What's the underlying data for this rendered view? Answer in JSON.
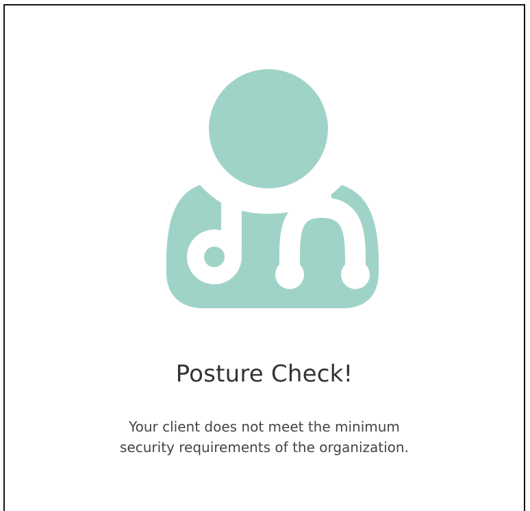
{
  "illustration": {
    "icon": "doctor-stethoscope-icon",
    "color": "#A0D3C7"
  },
  "title": "Posture Check!",
  "message": {
    "line1": "Your client does not meet the minimum",
    "line2": "security requirements of the organization."
  },
  "colors": {
    "title": "#333333",
    "message": "#444444",
    "border": "#111111",
    "background": "#FFFFFF"
  }
}
